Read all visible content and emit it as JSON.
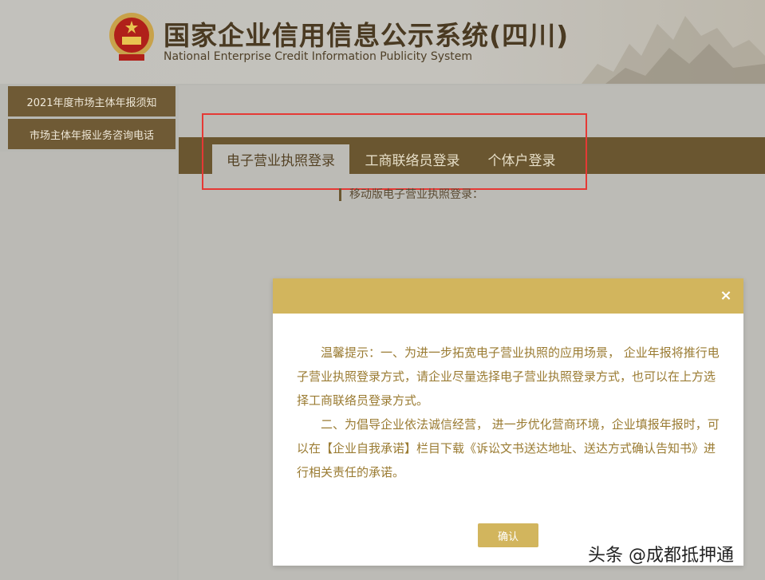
{
  "header": {
    "title_cn": "国家企业信用信息公示系统(四川)",
    "title_en": "National Enterprise Credit Information Publicity System"
  },
  "sidebar": {
    "items": [
      {
        "label": "2021年度市场主体年报须知"
      },
      {
        "label": "市场主体年报业务咨询电话"
      }
    ]
  },
  "tabs": [
    {
      "label": "电子营业执照登录",
      "active": true
    },
    {
      "label": "工商联络员登录",
      "active": false
    },
    {
      "label": "个体户登录",
      "active": false
    }
  ],
  "main": {
    "mobile_label": "移动版电子营业执照登录："
  },
  "modal": {
    "close_symbol": "×",
    "paragraph1": "温馨提示：一、为进一步拓宽电子营业执照的应用场景， 企业年报将推行电子营业执照登录方式，请企业尽量选择电子营业执照登录方式，也可以在上方选择工商联络员登录方式。",
    "paragraph2": "二、为倡导企业依法诚信经营， 进一步优化营商环境，企业填报年报时，可以在【企业自我承诺】栏目下载《诉讼文书送达地址、送达方式确认告知书》进行相关责任的承诺。",
    "confirm_label": "确认"
  },
  "watermark": "头条 @成都抵押通",
  "colors": {
    "brand_brown": "#6a5630",
    "modal_gold": "#d2b55d",
    "modal_text": "#9a7b32",
    "highlight_red": "#e53935"
  },
  "icons": {
    "emblem": "national-emblem-icon",
    "close": "close-icon"
  }
}
